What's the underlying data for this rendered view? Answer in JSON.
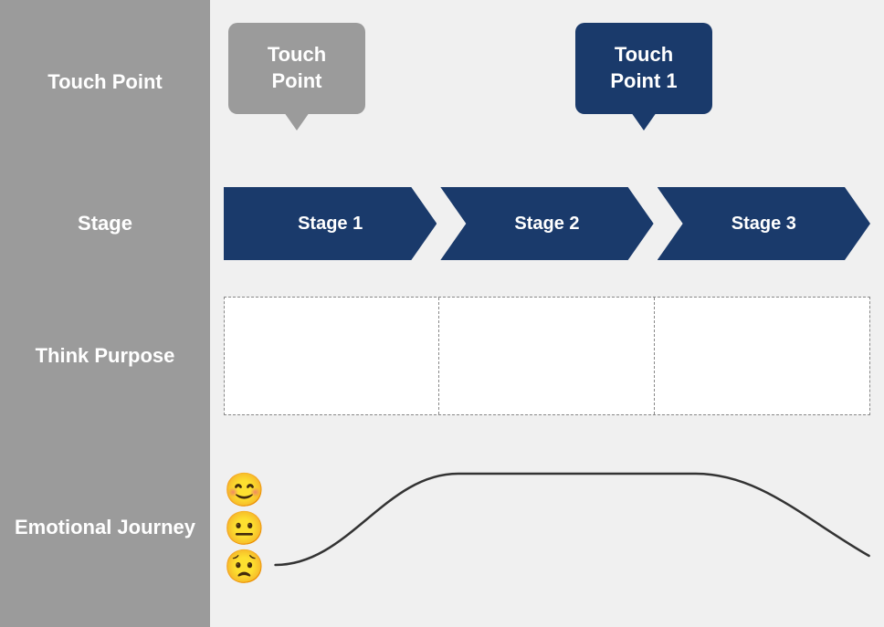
{
  "rows": {
    "touchpoint": {
      "label": "Touch\nPoint",
      "bubble_gray_text": "Touch\nPoint",
      "bubble_dark_text": "Touch\nPoint 1"
    },
    "stage": {
      "label": "Stage",
      "stages": [
        "Stage 1",
        "Stage 2",
        "Stage 3"
      ]
    },
    "think": {
      "label": "Think\nPurpose",
      "columns": [
        "",
        "",
        ""
      ]
    },
    "emotional": {
      "label": "Emotional\nJourney",
      "emojis": [
        "😊",
        "😐",
        "😟"
      ]
    }
  },
  "colors": {
    "dark_blue": "#1a3a6b",
    "gray": "#9b9b9b",
    "bg": "#f0f0f0"
  }
}
